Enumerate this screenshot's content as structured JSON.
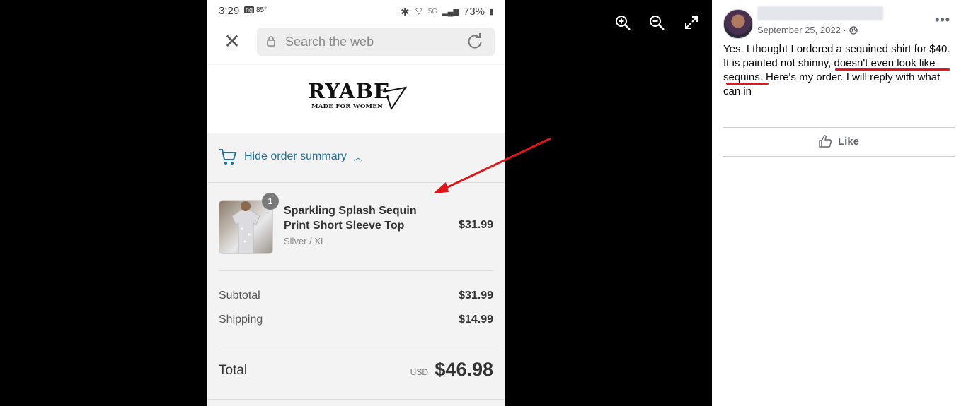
{
  "photo": {
    "status_bar": {
      "time": "3:29",
      "carrier_icon": "ng",
      "temperature": "85°",
      "network": "5G",
      "battery": "73%"
    },
    "browser": {
      "search_placeholder": "Search the web"
    },
    "brand": {
      "logo_text": "RYABE",
      "logo_tagline": "MADE FOR WOMEN"
    },
    "order_summary": {
      "toggle_label": "Hide order summary",
      "item": {
        "name": "Sparkling Splash Sequin Print Short Sleeve Top",
        "variant": "Silver / XL",
        "price": "$31.99",
        "quantity": "1"
      },
      "subtotal_label": "Subtotal",
      "subtotal_value": "$31.99",
      "shipping_label": "Shipping",
      "shipping_value": "$14.99",
      "total_label": "Total",
      "total_currency": "USD",
      "total_value": "$46.98"
    }
  },
  "viewer_controls": [
    "zoom-in-icon",
    "zoom-out-icon",
    "fullscreen-icon"
  ],
  "post": {
    "date": "September 25, 2022 ·",
    "text": "Yes. I thought I ordered a sequined shirt for $40. It is painted not shinny, doesn't even look like sequins. Here's my order. I will reply with what can in",
    "like_label": "Like"
  },
  "colors": {
    "link_blue": "#1f6f9f",
    "annotation_red": "#e0161a"
  }
}
